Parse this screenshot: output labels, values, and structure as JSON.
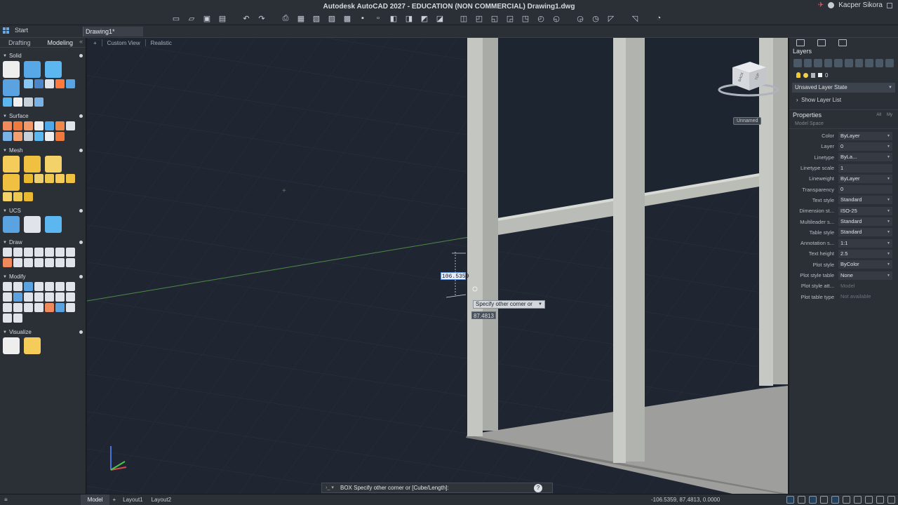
{
  "window": {
    "title": "Autodesk AutoCAD 2027 - EDUCATION (NON COMMERCIAL)    Drawing1.dwg",
    "user": "Kacper Sikora",
    "qat_icons": [
      "new-icon",
      "open-icon",
      "save-icon",
      "saveas-icon",
      "undo-icon",
      "redo-icon",
      "plot-icon",
      "print-preview-icon",
      "publish-icon",
      "share-icon",
      "layer-icon",
      "insert-icon",
      "block-icon",
      "match-icon",
      "view-icon",
      "zoom-window-icon",
      "pan-icon",
      "orbit-icon",
      "measure-icon",
      "properties-icon",
      "refresh-icon",
      "table-icon",
      "extract-icon",
      "viewcube-icon",
      "send-icon",
      "markup-icon",
      "review-icon",
      "app-store-icon",
      "search-icon"
    ]
  },
  "tabs": {
    "start": "Start",
    "drawing": "Drawing1*"
  },
  "palette": {
    "tabs": [
      "Drafting",
      "Modeling"
    ],
    "active_tab": "Modeling",
    "sections": [
      {
        "title": "Solid",
        "colors": [
          "#eeeeee",
          "#58a8e8",
          "#5cb7f0",
          "#5aa2e0",
          "#88c7f6",
          "#4a86c8",
          "#e0e4ea",
          "#ff7a3b",
          "#5aa2e0",
          "#5cb7f0",
          "#f0f0f0",
          "#c8d0da",
          "#7bb2e6"
        ]
      },
      {
        "title": "Surface",
        "colors": [
          "#f28a5c",
          "#f07a3c",
          "#f29a6c",
          "#eeeeee",
          "#4fa8e8",
          "#f0884a",
          "#dfe4ea",
          "#7bb2e6",
          "#f2a070",
          "#c8d0da",
          "#5cb7f0",
          "#eeeeee",
          "#f07a3c"
        ]
      },
      {
        "title": "Mesh",
        "colors": [
          "#f5cc5a",
          "#f0c040",
          "#f4d26a",
          "#f0c040",
          "#e8b830",
          "#ecd070",
          "#ecc850",
          "#f5cc5a",
          "#f0c040",
          "#f4d26a",
          "#ecc850",
          "#e8b830"
        ]
      },
      {
        "title": "UCS",
        "colors": [
          "#5aa2e0",
          "#e0e4ea",
          "#5cb7f0"
        ]
      },
      {
        "title": "Draw",
        "colors": [
          "#e0e4ea",
          "#e0e4ea",
          "#e0e4ea",
          "#e0e4ea",
          "#e0e4ea",
          "#e0e4ea",
          "#e0e4ea",
          "#f08a5c",
          "#e0e4ea",
          "#e0e4ea",
          "#e0e4ea",
          "#e0e4ea",
          "#e0e4ea",
          "#e0e4ea"
        ]
      },
      {
        "title": "Modify",
        "colors": [
          "#e0e4ea",
          "#e0e4ea",
          "#5aa2e0",
          "#e0e4ea",
          "#e0e4ea",
          "#e0e4ea",
          "#e0e4ea",
          "#e0e4ea",
          "#5aa2e0",
          "#e0e4ea",
          "#e0e4ea",
          "#e0e4ea",
          "#e0e4ea",
          "#e0e4ea",
          "#e0e4ea",
          "#e0e4ea",
          "#e0e4ea",
          "#e0e4ea",
          "#f08a5c",
          "#5aa2e0",
          "#e0e4ea",
          "#e0e4ea",
          "#e0e4ea"
        ]
      },
      {
        "title": "Visualize",
        "colors": [
          "#eeeeee",
          "#f5cc5a"
        ]
      }
    ]
  },
  "viewport": {
    "view": "Custom View",
    "style": "Realistic",
    "dyn_value_1": "106.5359",
    "dyn_value_2": "87.4813",
    "prompt": "Specify other corner or",
    "viewcube_label": "Unnamed",
    "viewcube_faces": [
      "BACK",
      "TOP"
    ]
  },
  "layers": {
    "title": "Layers",
    "current_layer": "0",
    "layer_state": "Unsaved Layer State",
    "show_layer_list": "Show Layer List"
  },
  "properties": {
    "title": "Properties",
    "tab_all": "All",
    "tab_my": "My",
    "space": "Model Space",
    "rows": [
      {
        "name": "Color",
        "value": "ByLayer"
      },
      {
        "name": "Layer",
        "value": "0"
      },
      {
        "name": "Linetype",
        "value": "ByLa..."
      },
      {
        "name": "Linetype scale",
        "value": "1"
      },
      {
        "name": "Lineweight",
        "value": "ByLayer"
      },
      {
        "name": "Transparency",
        "value": "0"
      },
      {
        "name": "Text style",
        "value": "Standard"
      },
      {
        "name": "Dimension st...",
        "value": "ISO-25"
      },
      {
        "name": "Multileader s...",
        "value": "Standard"
      },
      {
        "name": "Table style",
        "value": "Standard"
      },
      {
        "name": "Annotation s...",
        "value": "1:1"
      },
      {
        "name": "Text height",
        "value": "2.5"
      },
      {
        "name": "Plot style",
        "value": "ByColor"
      },
      {
        "name": "Plot style table",
        "value": "None"
      },
      {
        "name": "Plot style att...",
        "value": "Model"
      },
      {
        "name": "Plot table type",
        "value": "Not available"
      }
    ]
  },
  "command_line": {
    "text": "BOX Specify other corner or [Cube/Length]:"
  },
  "status": {
    "tabs": [
      "Model",
      "Layout1",
      "Layout2"
    ],
    "active": "Model",
    "coords": "-106.5359, 87.4813, 0.0000"
  }
}
